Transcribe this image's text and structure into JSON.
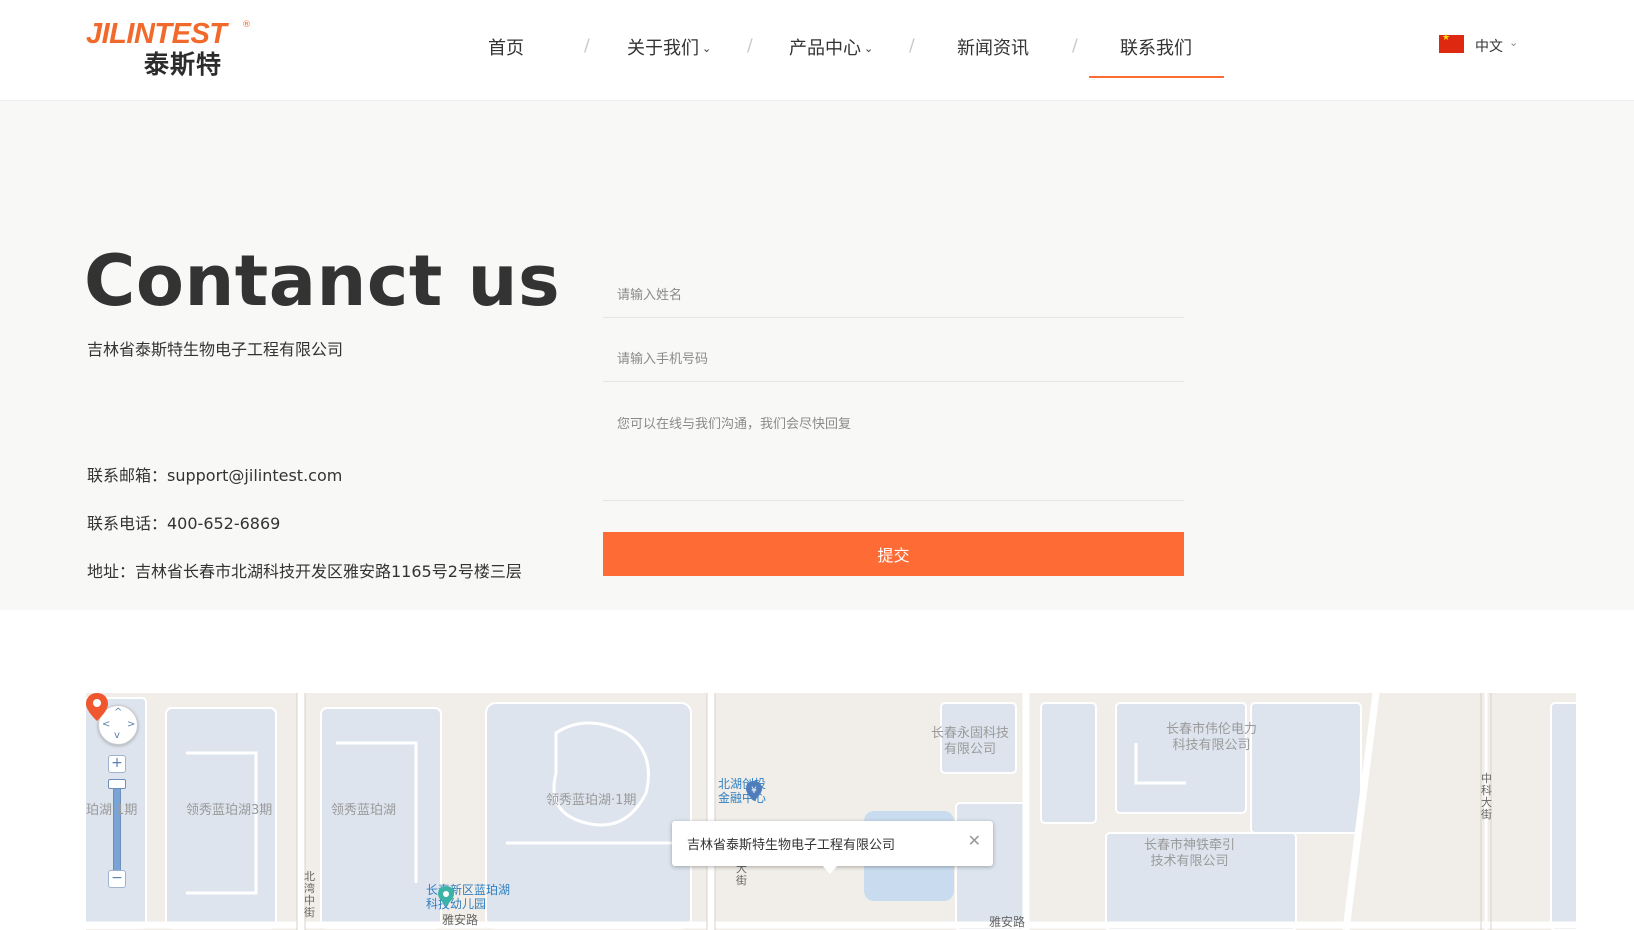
{
  "header": {
    "logo_en": "JILINTEST",
    "logo_reg": "®",
    "logo_cn": "泰斯特",
    "nav": [
      {
        "label": "首页",
        "chevron": ""
      },
      {
        "label": "关于我们",
        "chevron": "⌄"
      },
      {
        "label": "产品中心",
        "chevron": "⌄"
      },
      {
        "label": "新闻资讯",
        "chevron": ""
      },
      {
        "label": "联系我们",
        "chevron": ""
      }
    ],
    "nav_separator": "/",
    "active_nav": "联系我们",
    "accent_color": "#ff6b35",
    "language": {
      "label": "中文",
      "chevron": "⌄",
      "flag_icon": "china-flag-icon"
    }
  },
  "contact": {
    "title": "Contanct us",
    "company": "吉林省泰斯特生物电子工程有限公司",
    "email_line": "联系邮箱：support@jilintest.com",
    "phone_line": "联系电话：400-652-6869",
    "address_line": "地址：吉林省长春市北湖科技开发区雅安路1165号2号楼三层",
    "form": {
      "name_placeholder": "请输入姓名",
      "phone_placeholder": "请输入手机号码",
      "message_placeholder": "您可以在线与我们沟通，我们会尽快回复",
      "submit_label": "提交"
    }
  },
  "map": {
    "labels": {
      "l1": "领秀蓝珀湖3期",
      "l2": "领秀蓝珀湖",
      "l3": "领秀蓝珀湖·1期",
      "l4": "珀湖·1期",
      "l5": "长春永固科技\n有限公司",
      "l6": "长春市伟伦电力\n科技有限公司",
      "l7": "长春市神铁牵引\n技术有限公司",
      "l8": "北湖创投\n金融中心",
      "l9": "长春新区蓝珀湖\n科技幼儿园",
      "l10": "雅安路",
      "l11": "雅安路",
      "l12": "北\n湾\n中\n街",
      "l13": "中\n科\n大\n街",
      "l14": "大\n街"
    },
    "infowindow_text": "吉林省泰斯特生物电子工程有限公司",
    "infowindow_close": "✕",
    "zoom_in": "+",
    "zoom_out": "−"
  }
}
